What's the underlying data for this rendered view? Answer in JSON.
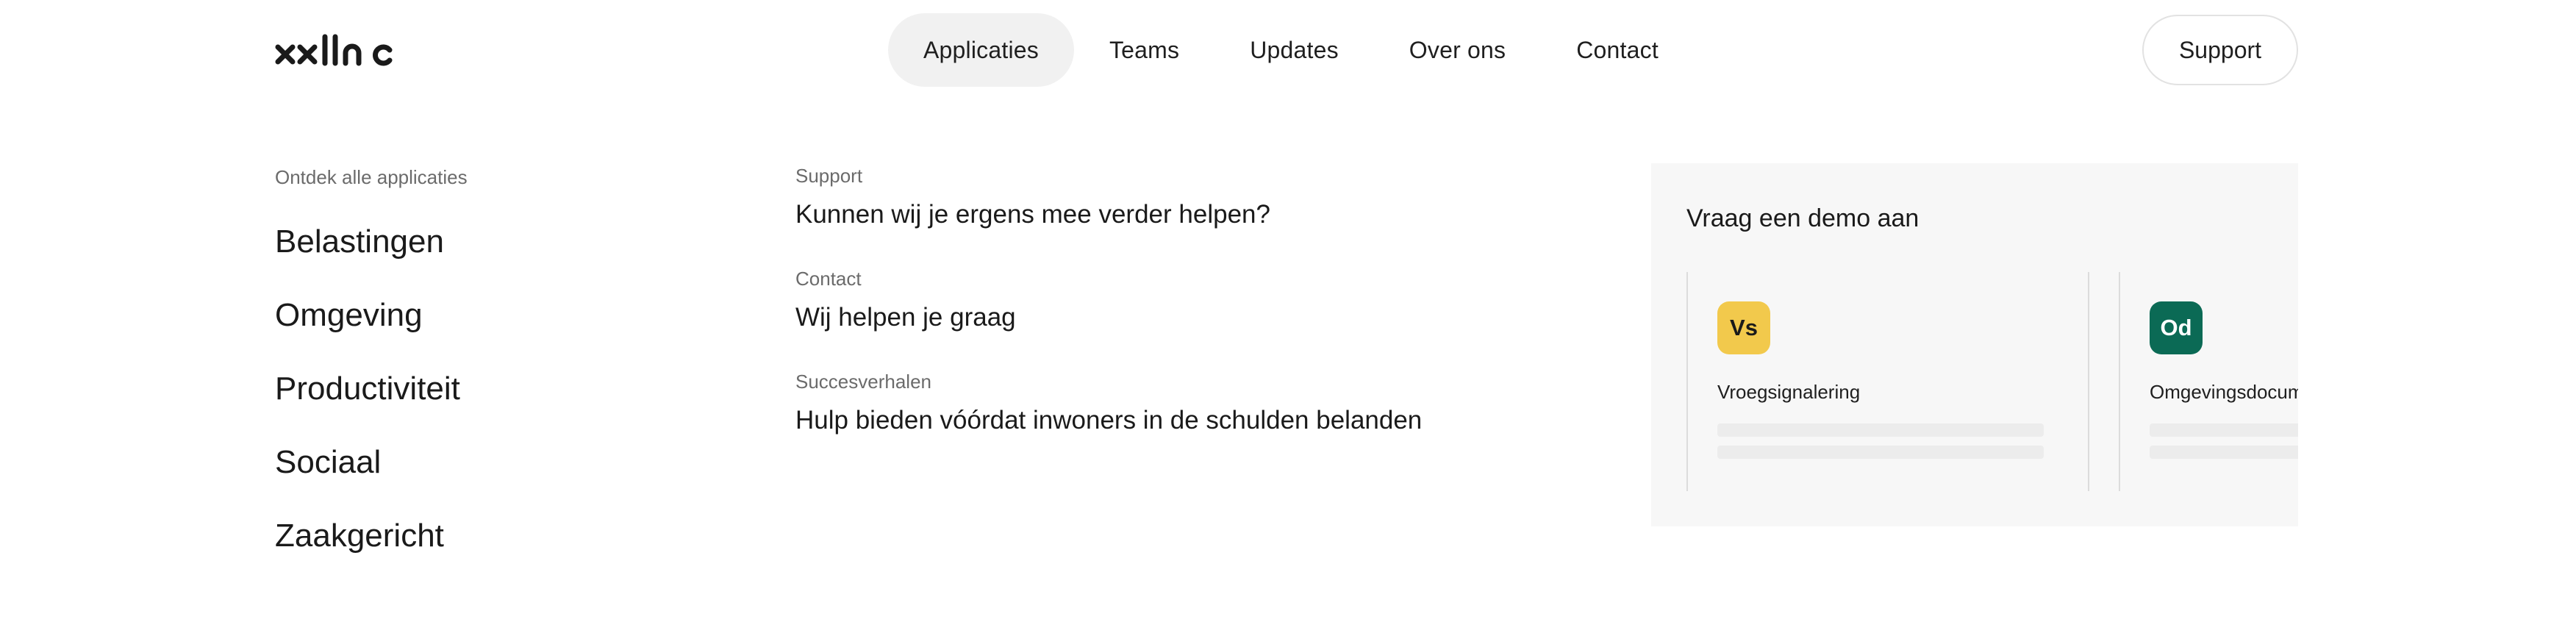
{
  "header": {
    "logo_text": "xxllnc",
    "nav": [
      "Applicaties",
      "Teams",
      "Updates",
      "Over ons",
      "Contact"
    ],
    "active_nav": "Applicaties",
    "support_button": "Support"
  },
  "applications": {
    "intro": "Ontdek alle applicaties",
    "categories": [
      "Belastingen",
      "Omgeving",
      "Productiviteit",
      "Sociaal",
      "Zaakgericht"
    ]
  },
  "links": [
    {
      "label": "Support",
      "text": "Kunnen wij je ergens mee verder helpen?"
    },
    {
      "label": "Contact",
      "text": "Wij helpen je graag"
    },
    {
      "label": "Succesverhalen",
      "text": "Hulp bieden vóórdat inwoners in de schulden belanden"
    }
  ],
  "demo": {
    "title": "Vraag een demo aan",
    "cards": [
      {
        "abbr": "Vs",
        "name": "Vroegsignalering",
        "badge_color": "#f2c94c",
        "badge_text_color": "#1a1a1a"
      },
      {
        "abbr": "Od",
        "name": "Omgevingsdocumenten",
        "badge_color": "#0b6a55",
        "badge_text_color": "#ffffff"
      }
    ]
  },
  "colors": {
    "active_nav_bg": "#f1f1f1",
    "panel_bg": "#f7f7f7",
    "text": "#1c1c1c",
    "muted": "#6b6b6b"
  }
}
